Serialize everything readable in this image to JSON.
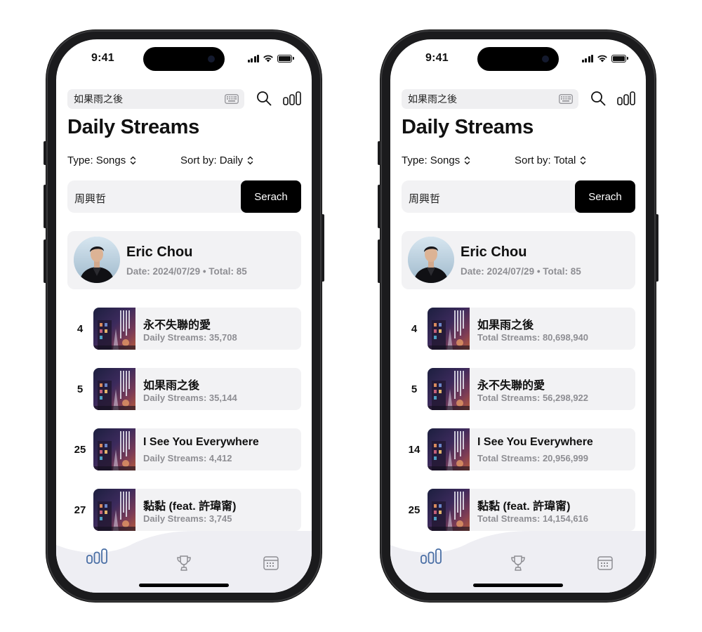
{
  "phones": [
    {
      "status": {
        "time": "9:41"
      },
      "search": {
        "value": "如果雨之後"
      },
      "page_title": "Daily Streams",
      "filters": {
        "type_label": "Type:",
        "type_value": "Songs",
        "sort_label": "Sort by:",
        "sort_value": "Daily"
      },
      "query": {
        "value": "周興哲",
        "button_label": "Serach"
      },
      "artist": {
        "name": "Eric Chou",
        "meta": "Date: 2024/07/29 • Total: 85"
      },
      "songs": [
        {
          "rank": "4",
          "title": "永不失聯的愛",
          "sub": "Daily Streams: 35,708"
        },
        {
          "rank": "5",
          "title": "如果雨之後",
          "sub": "Daily Streams: 35,144"
        },
        {
          "rank": "25",
          "title": "I See You Everywhere",
          "sub": "Daily Streams: 4,412"
        },
        {
          "rank": "27",
          "title": "黏黏 (feat. 許瑋甯)",
          "sub": "Daily Streams: 3,745"
        }
      ]
    },
    {
      "status": {
        "time": "9:41"
      },
      "search": {
        "value": "如果雨之後"
      },
      "page_title": "Daily Streams",
      "filters": {
        "type_label": "Type:",
        "type_value": "Songs",
        "sort_label": "Sort by:",
        "sort_value": "Total"
      },
      "query": {
        "value": "周興哲",
        "button_label": "Serach"
      },
      "artist": {
        "name": "Eric Chou",
        "meta": "Date: 2024/07/29 • Total: 85"
      },
      "songs": [
        {
          "rank": "4",
          "title": "如果雨之後",
          "sub": "Total Streams: 80,698,940"
        },
        {
          "rank": "5",
          "title": "永不失聯的愛",
          "sub": "Total Streams: 56,298,922"
        },
        {
          "rank": "14",
          "title": "I See You Everywhere",
          "sub": "Total Streams: 20,956,999"
        },
        {
          "rank": "25",
          "title": "黏黏 (feat. 許瑋甯)",
          "sub": "Total Streams: 14,154,616"
        }
      ]
    }
  ],
  "icons": {
    "keyboard": "keyboard-icon",
    "search": "search-icon",
    "stats": "bar-chart-icon",
    "trophy": "trophy-icon",
    "calendar": "calendar-icon"
  },
  "colors": {
    "accent": "#4a6fa5",
    "card_bg": "#f2f2f4",
    "tab_bg": "#eeeef3",
    "muted_text": "#8e8e93",
    "button_bg": "#000000"
  }
}
